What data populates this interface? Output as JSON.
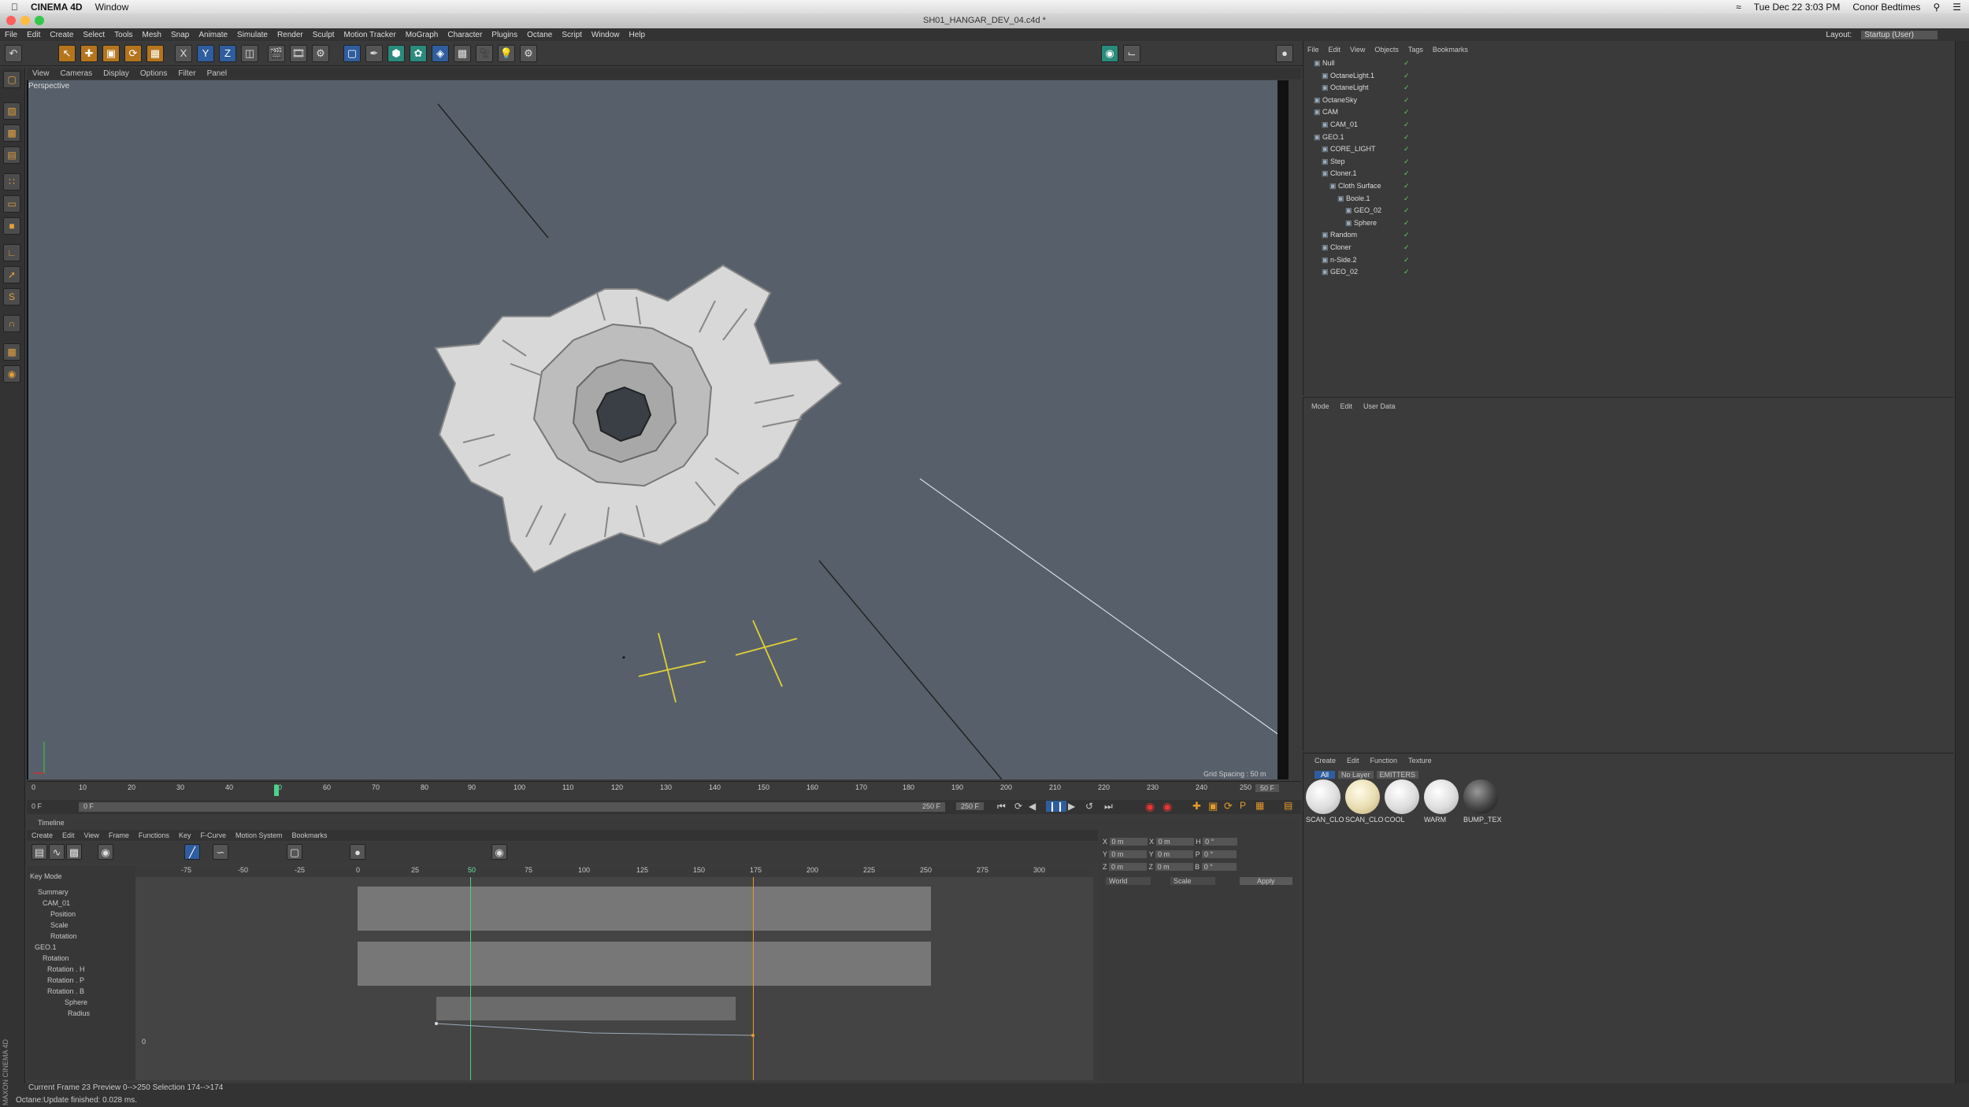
{
  "mac_menubar": {
    "app_name": "CINEMA 4D",
    "window_menu": "Window",
    "clock": "Tue Dec 22  3:03 PM",
    "user": "Conor Bedtimes"
  },
  "window": {
    "title": "SH01_HANGAR_DEV_04.c4d *"
  },
  "main_menu": [
    "File",
    "Edit",
    "Create",
    "Select",
    "Tools",
    "Mesh",
    "Snap",
    "Animate",
    "Simulate",
    "Render",
    "Sculpt",
    "Motion Tracker",
    "MoGraph",
    "Character",
    "Plugins",
    "Octane",
    "Script",
    "Window",
    "Help"
  ],
  "layout": {
    "label": "Layout:",
    "value": "Startup (User)"
  },
  "toolbar_axes": [
    "X",
    "Y",
    "Z"
  ],
  "viewport": {
    "menu": [
      "View",
      "Cameras",
      "Display",
      "Options",
      "Filter",
      "Panel"
    ],
    "label": "Perspective",
    "grid_spacing": "Grid Spacing : 50 m"
  },
  "ruler_ticks": [
    "0",
    "10",
    "20",
    "30",
    "40",
    "50",
    "60",
    "70",
    "80",
    "90",
    "100",
    "110",
    "120",
    "130",
    "140",
    "150",
    "160",
    "170",
    "180",
    "190",
    "200",
    "210",
    "220",
    "230",
    "240",
    "250"
  ],
  "frame_field": "50 F",
  "range": {
    "start": "0 F",
    "start2": "0 F",
    "end": "250 F",
    "end2": "250 F"
  },
  "timeline": {
    "title": "Timeline",
    "menu": [
      "Create",
      "Edit",
      "View",
      "Frame",
      "Functions",
      "Key",
      "F-Curve",
      "Motion System",
      "Bookmarks"
    ],
    "key_mode": "Key Mode",
    "ticks": [
      "-75",
      "-50",
      "-25",
      "0",
      "25",
      "50",
      "75",
      "100",
      "125",
      "150",
      "175",
      "200",
      "225",
      "250",
      "275",
      "300"
    ],
    "current_marker": "50",
    "zero_label": "0",
    "tracks": [
      "Summary",
      "CAM_01",
      "Position",
      "Scale",
      "Rotation",
      "GEO.1",
      "Rotation",
      "Rotation . H",
      "Rotation . P",
      "Rotation . B",
      "Sphere",
      "Radius"
    ],
    "status": "Current Frame  23   Preview  0-->250    Selection 174-->174"
  },
  "coords": {
    "rows": [
      [
        "X",
        "0 m",
        "X",
        "0 m",
        "H",
        "0 °"
      ],
      [
        "Y",
        "0 m",
        "Y",
        "0 m",
        "P",
        "0 °"
      ],
      [
        "Z",
        "0 m",
        "Z",
        "0 m",
        "B",
        "0 °"
      ]
    ],
    "world": "World",
    "scale": "Scale",
    "apply": "Apply"
  },
  "objects_panel": {
    "menu": [
      "File",
      "Edit",
      "View",
      "Objects",
      "Tags",
      "Bookmarks"
    ],
    "items": [
      "Null",
      "OctaneLight.1",
      "OctaneLight",
      "OctaneSky",
      "CAM",
      "CAM_01",
      "GEO.1",
      "CORE_LIGHT",
      "Step",
      "Cloner.1",
      "Cloth Surface",
      "Boole.1",
      "GEO_02",
      "Sphere",
      "Random",
      "Cloner",
      "n-Side.2",
      "GEO_02"
    ],
    "indent": [
      0,
      1,
      1,
      0,
      0,
      1,
      0,
      1,
      1,
      1,
      2,
      3,
      4,
      4,
      1,
      1,
      1,
      1
    ]
  },
  "attributes_panel": {
    "menu": [
      "Mode",
      "Edit",
      "User Data"
    ]
  },
  "materials": {
    "menu": [
      "Create",
      "Edit",
      "Function",
      "Texture"
    ],
    "filters": [
      "All",
      "No Layer",
      "EMITTERS"
    ],
    "items": [
      "SCAN_CLO",
      "SCAN_CLO",
      "COOL",
      "WARM",
      "BUMP_TEX"
    ]
  },
  "status_bar": "Octane:Update finished: 0.028 ms.",
  "brand": "MAXON CINEMA 4D",
  "colors": {
    "viewport_bg": "#57606a",
    "accent_orange": "#e69b2a",
    "selection_blue": "#2f5d9e"
  }
}
